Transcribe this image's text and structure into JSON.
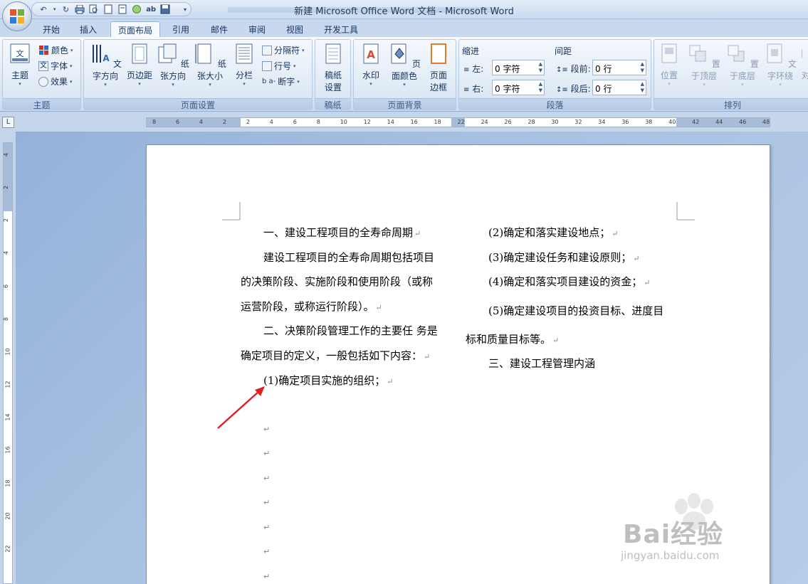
{
  "window": {
    "title": "新建 Microsoft Office Word 文档 - Microsoft Word"
  },
  "quick_access": {
    "icons": [
      "undo-icon",
      "redo-icon",
      "print-icon",
      "print-preview-icon",
      "new-doc-icon",
      "open-icon",
      "circle-icon",
      "spell-check-icon",
      "save-icon",
      "customize-icon"
    ]
  },
  "tabs": [
    "开始",
    "插入",
    "页面布局",
    "引用",
    "邮件",
    "审阅",
    "视图",
    "开发工具"
  ],
  "active_tab": "页面布局",
  "ribbon": {
    "themes": {
      "label": "主题",
      "themes_btn": "主题",
      "colors": "颜色",
      "fonts": "字体",
      "effects": "效果"
    },
    "page_setup": {
      "label": "页面设置",
      "text_direction": "文字方向",
      "margins": "页边距",
      "orientation": "纸张方向",
      "size": "纸张大小",
      "columns": "分栏",
      "breaks": "分隔符",
      "line_numbers": "行号",
      "hyphenation": "断字"
    },
    "draft": {
      "label": "稿纸",
      "draft_setup_1": "稿纸",
      "draft_setup_2": "设置"
    },
    "background": {
      "label": "页面背景",
      "watermark": "水印",
      "page_color": "页面颜色",
      "page_borders_1": "页面",
      "page_borders_2": "边框"
    },
    "paragraph": {
      "label": "段落",
      "indent_title": "缩进",
      "spacing_title": "间距",
      "indent_left_label": "左:",
      "indent_left_value": "0 字符",
      "indent_right_label": "右:",
      "indent_right_value": "0 字符",
      "spacing_before_label": "段前:",
      "spacing_before_value": "0 行",
      "spacing_after_label": "段后:",
      "spacing_after_value": "0 行"
    },
    "arrange": {
      "label": "排列",
      "position": "位置",
      "bring_front": "置于顶层",
      "send_back": "置于底层",
      "text_wrap": "文字环绕",
      "align": "对"
    }
  },
  "ruler": {
    "corner": "L",
    "h_ticks": [
      "8",
      "6",
      "4",
      "2",
      "2",
      "4",
      "6",
      "8",
      "10",
      "12",
      "14",
      "16",
      "18",
      "22",
      "24",
      "26",
      "28",
      "30",
      "32",
      "34",
      "36",
      "38",
      "40",
      "42",
      "44",
      "46",
      "48"
    ],
    "v_ticks": [
      "4",
      "2",
      "2",
      "4",
      "6",
      "8",
      "10",
      "12",
      "14",
      "16",
      "18",
      "20",
      "22"
    ]
  },
  "document": {
    "left_column": [
      "一、建设工程项目的全寿命周期",
      "建设工程项目的全寿命周期包括项目",
      "的决策阶段、实施阶段和使用阶段（或称",
      "运营阶段，或称运行阶段）。",
      "二、决策阶段管理工作的主要任  务是",
      "确定项目的定义，一般包括如下内容：",
      "(1)确定项目实施的组织；"
    ],
    "right_column": [
      "(2)确定和落实建设地点；",
      "(3)确定建设任务和建设原则；",
      "(4)确定和落实项目建设的资金；",
      "(5)确定建设项目的投资目标、进度目",
      "标和质量目标等。",
      "三、建设工程管理内涵"
    ],
    "paragraph_mark": "↵"
  },
  "watermark": {
    "brand": "Bai经验",
    "url": "jingyan.baidu.com"
  }
}
